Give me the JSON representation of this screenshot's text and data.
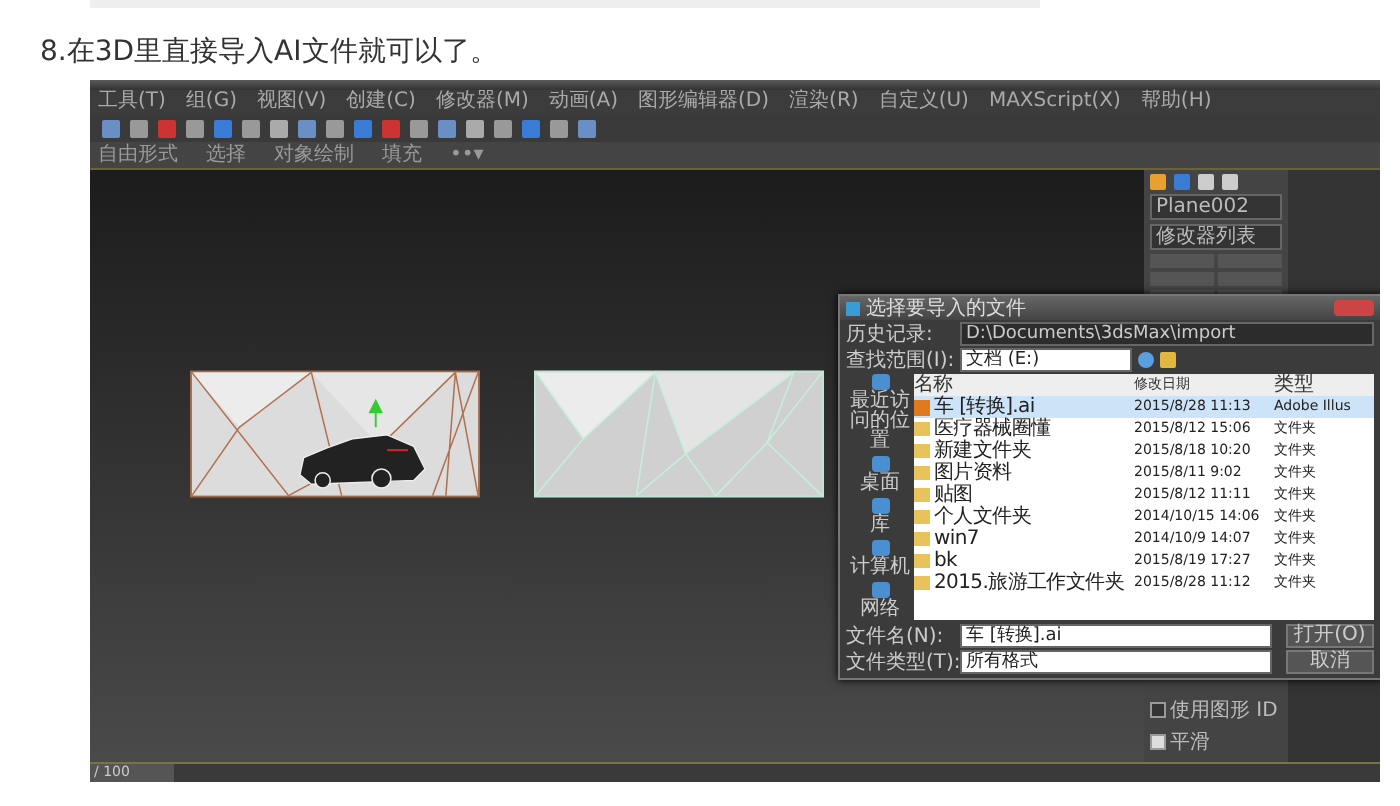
{
  "heading": "8.在3D里直接导入AI文件就可以了。",
  "app": {
    "menus": [
      "工具(T)",
      "组(G)",
      "视图(V)",
      "创建(C)",
      "修改器(M)",
      "动画(A)",
      "图形编辑器(D)",
      "渲染(R)",
      "自定义(U)",
      "MAXScript(X)",
      "帮助(H)"
    ],
    "ribbon_tabs": [
      "自由形式",
      "选择",
      "对象绘制",
      "填充",
      "••▾"
    ],
    "command_panel": {
      "object_name": "Plane002",
      "modifier_list": "修改器列表"
    },
    "options": [
      {
        "label": "使用图形 ID",
        "checked": false
      },
      {
        "label": "平滑",
        "checked": true
      }
    ],
    "time_slider": {
      "label": "/ 100",
      "level": 0
    }
  },
  "dialog": {
    "title": "选择要导入的文件",
    "history_label": "历史记录:",
    "history": "D:\\Documents\\3dsMax\\import",
    "look_in_label": "查找范围(I):",
    "look_in": "文档 (E:)",
    "places": [
      "最近访问的位置",
      "桌面",
      "库",
      "计算机",
      "网络"
    ],
    "columns": [
      "名称",
      "修改日期",
      "类型"
    ],
    "rows": [
      {
        "kind": "ai",
        "name": "车 [转换].ai",
        "date": "2015/8/28 11:13",
        "type": "Adobe Illus",
        "selected": true
      },
      {
        "kind": "folder",
        "name": "医疗器械圈懂",
        "date": "2015/8/12 15:06",
        "type": "文件夹",
        "selected": false
      },
      {
        "kind": "folder",
        "name": "新建文件夹",
        "date": "2015/8/18 10:20",
        "type": "文件夹",
        "selected": false
      },
      {
        "kind": "folder",
        "name": "图片资料",
        "date": "2015/8/11 9:02",
        "type": "文件夹",
        "selected": false
      },
      {
        "kind": "folder",
        "name": "贴图",
        "date": "2015/8/12 11:11",
        "type": "文件夹",
        "selected": false
      },
      {
        "kind": "folder",
        "name": "个人文件夹",
        "date": "2014/10/15 14:06",
        "type": "文件夹",
        "selected": false
      },
      {
        "kind": "folder",
        "name": "win7",
        "date": "2014/10/9 14:07",
        "type": "文件夹",
        "selected": false
      },
      {
        "kind": "folder",
        "name": "bk",
        "date": "2015/8/19 17:27",
        "type": "文件夹",
        "selected": false
      },
      {
        "kind": "folder",
        "name": "2015.旅游工作文件夹",
        "date": "2015/8/28 11:12",
        "type": "文件夹",
        "selected": false
      }
    ],
    "file_name_label": "文件名(N):",
    "file_name": "车 [转换].ai",
    "file_type_label": "文件类型(T):",
    "file_type": "所有格式",
    "buttons": [
      "打开(O)",
      "取消"
    ]
  }
}
